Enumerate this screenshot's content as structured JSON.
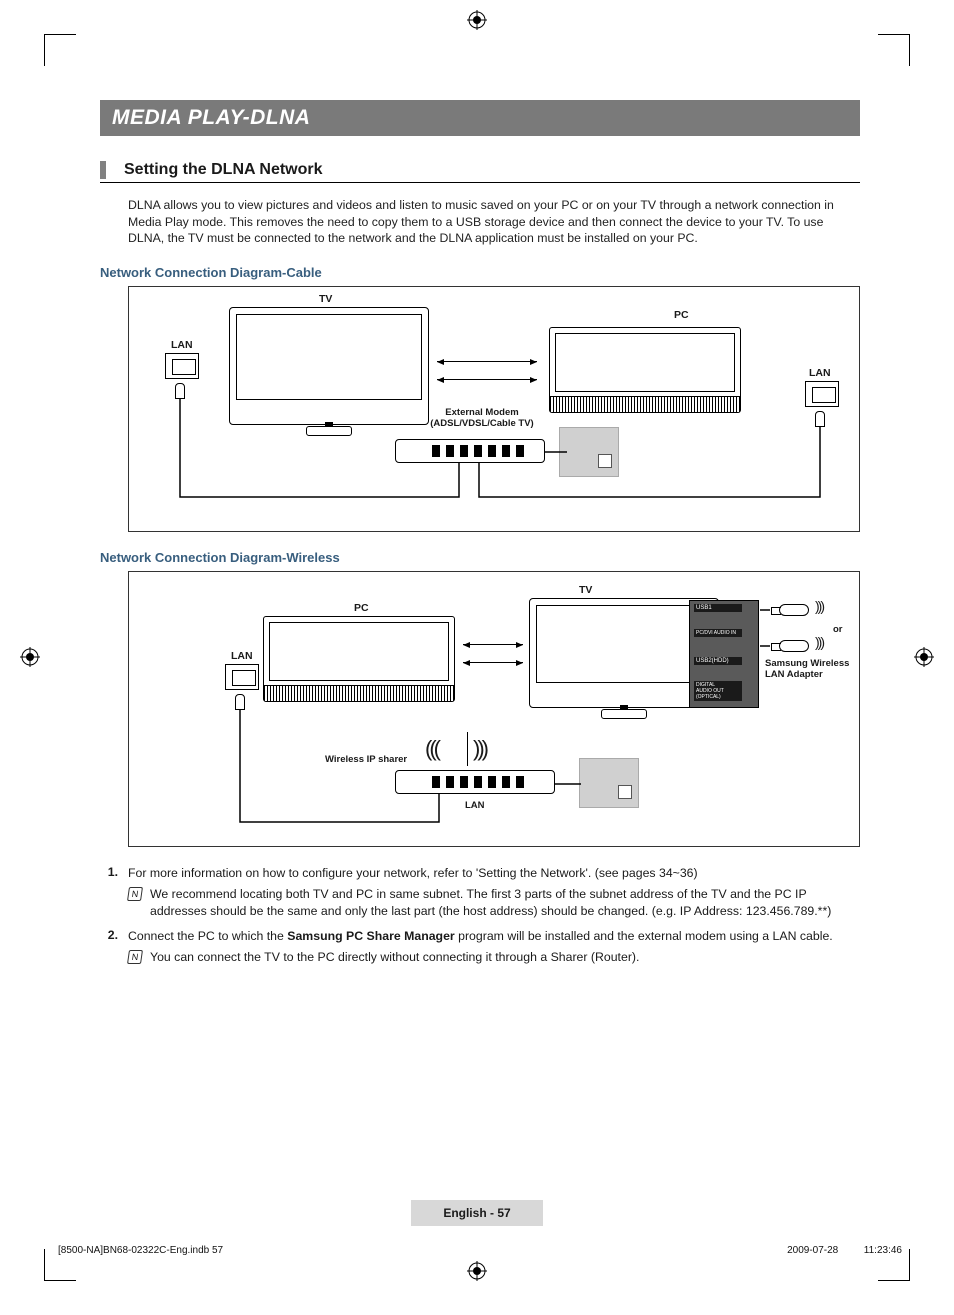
{
  "banner": "MEDIA PLAY-DLNA",
  "section1": {
    "title": "Setting the DLNA Network",
    "intro": "DLNA allows you to view pictures and videos and listen to music saved on your PC or on your TV through a network connection in Media Play mode. This removes the need to copy them to a USB storage device and then connect the device to your TV. To use DLNA, the TV must be connected to the network and the DLNA application must be installed on your PC."
  },
  "diagramCable": {
    "heading": "Network Connection Diagram-Cable",
    "tvLabel": "TV",
    "pcLabel": "PC",
    "lanLeft": "LAN",
    "lanRight": "LAN",
    "modemLabel1": "External Modem",
    "modemLabel2": "(ADSL/VDSL/Cable TV)"
  },
  "diagramWireless": {
    "heading": "Network Connection Diagram-Wireless",
    "pcLabel": "PC",
    "tvLabel": "TV",
    "lanLabel": "LAN",
    "lanBottom": "LAN",
    "sharerLabel": "Wireless IP sharer",
    "orLabel": "or",
    "adapterLabel1": "Samsung Wireless",
    "adapterLabel2": "LAN Adapter",
    "panelPorts": [
      "USB1",
      "PC/DVI\nAUDIO IN",
      "USB2(HDD)",
      "DIGITAL\nAUDIO OUT\n(OPTICAL)"
    ]
  },
  "steps": [
    {
      "num": "1.",
      "text": "For more information on how to configure your network, refer to 'Setting the Network'. (see pages 34~36)",
      "note": "We recommend locating both TV and PC in same subnet. The first 3 parts of the subnet address of the TV and the PC IP addresses should be the same and only the last part (the host address) should be changed. (e.g. IP Address: 123.456.789.**)"
    },
    {
      "num": "2.",
      "textParts": [
        "Connect the PC to which the ",
        "Samsung PC Share Manager",
        " program will be installed and the external modem using a LAN cable."
      ],
      "note": "You can connect the TV to the PC directly without connecting it through a Sharer (Router)."
    }
  ],
  "noteGlyph": "N",
  "footer": {
    "langPage": "English - 57",
    "file": "[8500-NA]BN68-02322C-Eng.indb   57",
    "timestamp": "2009-07-28      11:23:46"
  }
}
